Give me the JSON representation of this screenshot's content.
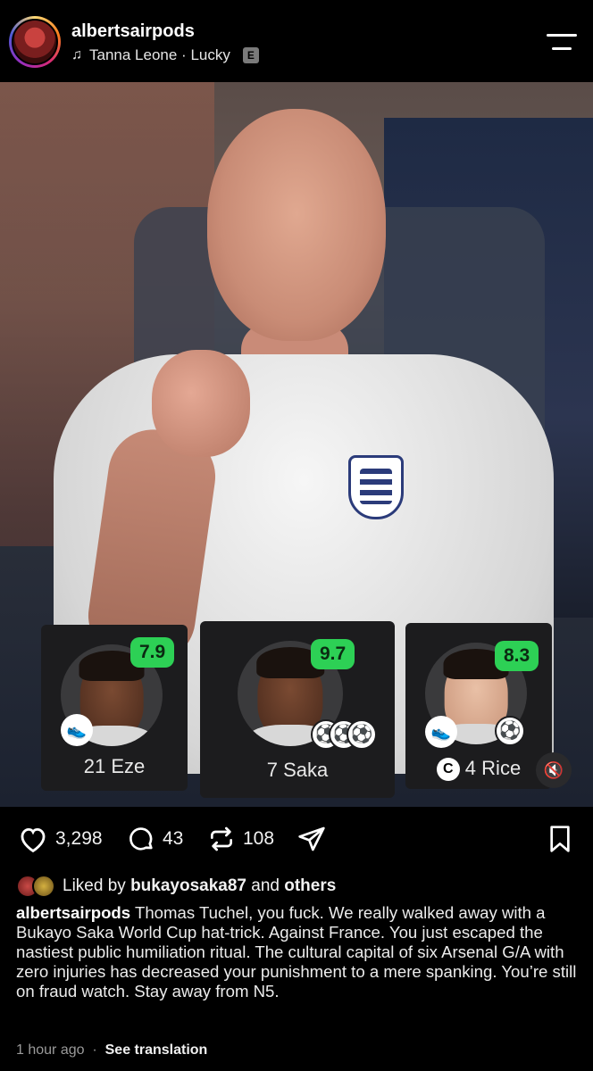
{
  "header": {
    "username": "albertsairpods",
    "song_artist": "Tanna Leone",
    "song_title": "Lucky",
    "song_separator": " · ",
    "explicit_label": "E"
  },
  "players": [
    {
      "rating": "7.9",
      "number": "21",
      "name": "Eze",
      "rating_color": "#2dd055"
    },
    {
      "rating": "9.7",
      "number": "7",
      "name": "Saka",
      "rating_color": "#2dd055"
    },
    {
      "rating": "8.3",
      "number": "4",
      "name": "Rice",
      "captain": "C",
      "rating_color": "#2dd055"
    }
  ],
  "actions": {
    "likes": "3,298",
    "comments": "43",
    "reposts": "108"
  },
  "liked_by": {
    "prefix": "Liked by",
    "user": "bukayosaka87",
    "joiner": "and",
    "suffix": "others"
  },
  "caption": {
    "author": "albertsairpods",
    "text": "Thomas Tuchel, you fuck. We really walked away with a Bukayo Saka World Cup hat-trick. Against France. You just escaped the nastiest public humiliation ritual. The cultural capital of six Arsenal G/A with zero injuries has decreased your punishment to a mere spanking. You’re still on fraud watch. Stay away from N5."
  },
  "meta": {
    "time": "1 hour ago",
    "dot": "·",
    "translate": "See translation"
  },
  "icons": {
    "music": "music-note-icon",
    "menu": "menu-icon",
    "like": "heart-icon",
    "comment": "comment-icon",
    "repost": "repost-icon",
    "share": "send-icon",
    "save": "bookmark-icon",
    "mute": "speaker-muted-icon"
  }
}
